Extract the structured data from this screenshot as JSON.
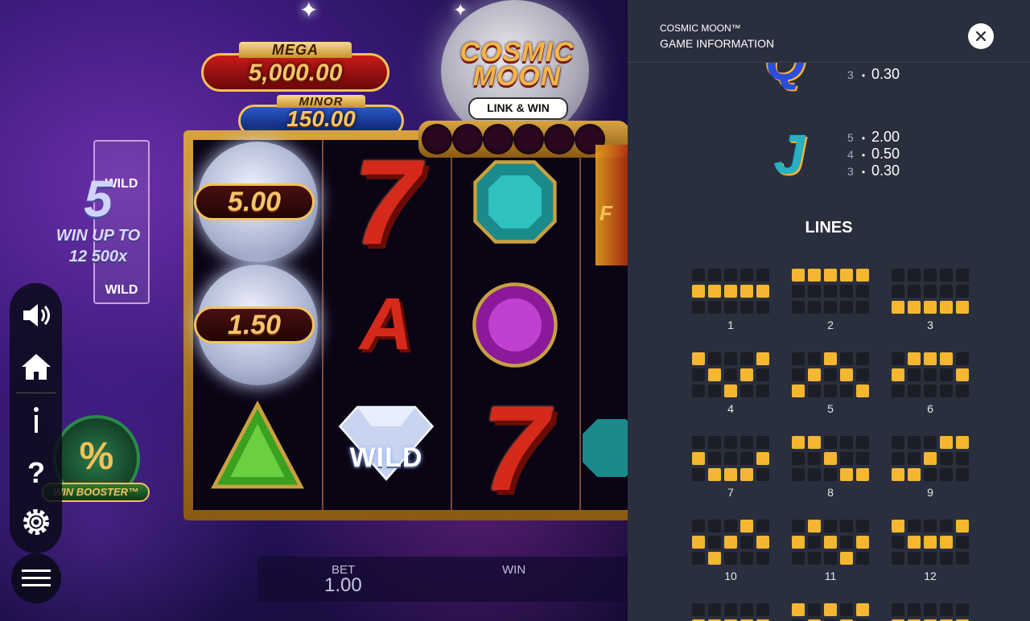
{
  "game": {
    "jackpots": {
      "mega": {
        "title": "MEGA",
        "value": "5,000.00"
      },
      "minor": {
        "title": "MINOR",
        "value": "150.00"
      }
    },
    "logo": {
      "title_line1": "COSMIC",
      "title_line2": "MOON",
      "subtitle": "LINK & WIN"
    },
    "reels": {
      "moon_values": [
        "5.00",
        "1.50"
      ],
      "wild_label": "WILD"
    },
    "win_up": {
      "number": "5",
      "line1": "WIN UP TO",
      "line2": "12 500x",
      "stack_label": "WILD"
    },
    "booster": {
      "label": "WIN BOOSTER™"
    },
    "bottom_bar": {
      "bet_label": "BET",
      "bet_value": "1.00",
      "win_label": "WIN"
    },
    "side_text": "F"
  },
  "menu": {
    "icons": [
      "speaker-icon",
      "home-icon",
      "info-icon",
      "help-icon",
      "gear-icon",
      "hamburger-menu-icon"
    ]
  },
  "panel": {
    "game_name": "COSMIC MOON™",
    "subtitle": "GAME INFORMATION",
    "close_icon": "close-icon",
    "paytable": [
      {
        "symbol": "Q",
        "rows": [
          {
            "count": "3",
            "value": "0.30"
          }
        ]
      },
      {
        "symbol": "J",
        "rows": [
          {
            "count": "5",
            "value": "2.00"
          },
          {
            "count": "4",
            "value": "0.50"
          },
          {
            "count": "3",
            "value": "0.30"
          }
        ]
      }
    ],
    "lines_title": "LINES",
    "lines": [
      {
        "number": "1",
        "pattern": [
          1,
          1,
          1,
          1,
          1
        ]
      },
      {
        "number": "2",
        "pattern": [
          0,
          0,
          0,
          0,
          0
        ]
      },
      {
        "number": "3",
        "pattern": [
          2,
          2,
          2,
          2,
          2
        ]
      },
      {
        "number": "4",
        "pattern": [
          0,
          1,
          2,
          1,
          0
        ]
      },
      {
        "number": "5",
        "pattern": [
          2,
          1,
          0,
          1,
          2
        ]
      },
      {
        "number": "6",
        "pattern": [
          1,
          0,
          0,
          0,
          1
        ]
      },
      {
        "number": "7",
        "pattern": [
          1,
          2,
          2,
          2,
          1
        ]
      },
      {
        "number": "8",
        "pattern": [
          0,
          0,
          1,
          2,
          2
        ]
      },
      {
        "number": "9",
        "pattern": [
          2,
          2,
          1,
          0,
          0
        ]
      },
      {
        "number": "10",
        "pattern": [
          1,
          2,
          1,
          0,
          1
        ]
      },
      {
        "number": "11",
        "pattern": [
          1,
          0,
          1,
          2,
          1
        ]
      },
      {
        "number": "12",
        "pattern": [
          0,
          1,
          1,
          1,
          0
        ]
      },
      {
        "number": "",
        "pattern": [
          1,
          1,
          1,
          1,
          1
        ]
      },
      {
        "number": "",
        "pattern": [
          0,
          1,
          0,
          1,
          0
        ]
      },
      {
        "number": "",
        "pattern": [
          1,
          1,
          1,
          1,
          1
        ]
      }
    ]
  },
  "colors": {
    "panel_bg": "#2a2f3d",
    "line_on": "#f5b731",
    "line_off": "#1b1e26",
    "accent_gold": "#f3c15a"
  }
}
